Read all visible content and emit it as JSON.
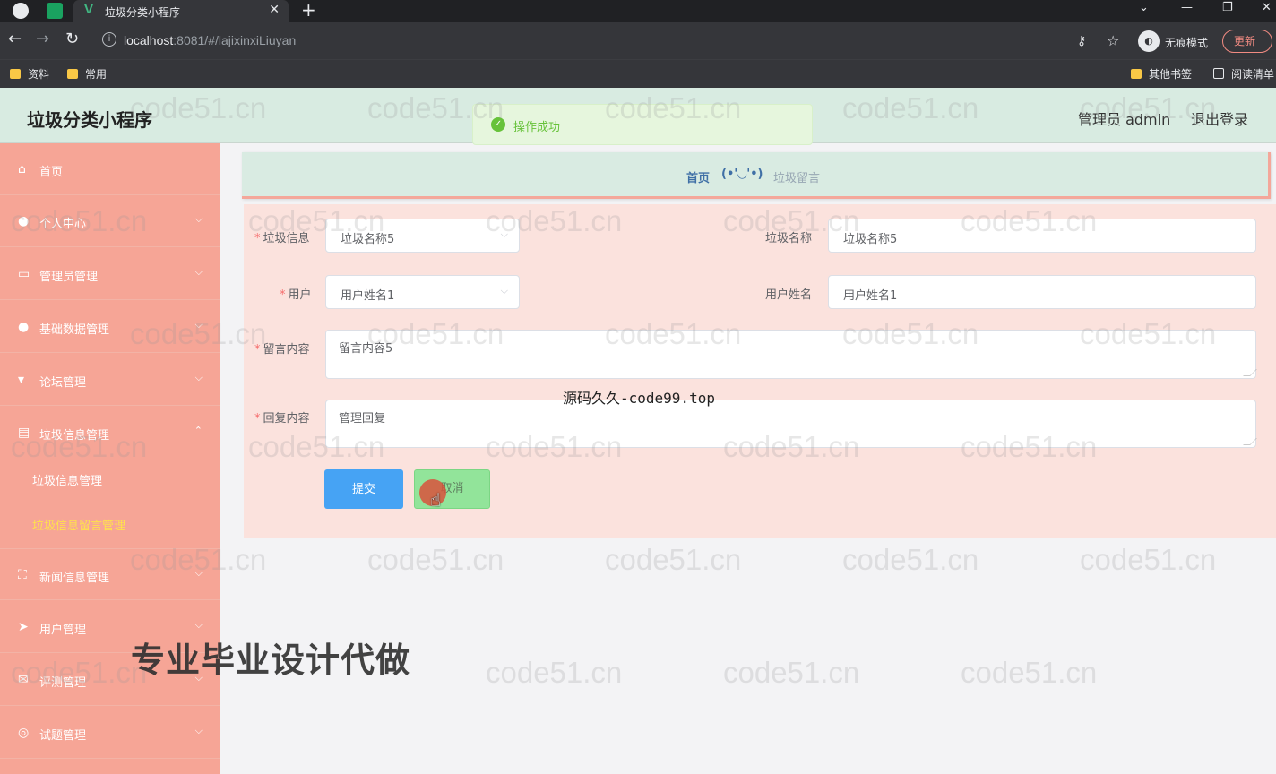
{
  "browser": {
    "tab_title": "垃圾分类小程序",
    "url_host": "localhost",
    "url_rest": ":8081/#/lajixinxiLiuyan",
    "incognito_label": "无痕模式",
    "update_label": "更新",
    "bookmarks": [
      "资料",
      "常用"
    ],
    "bookmarks_right": [
      "其他书签",
      "阅读清单"
    ]
  },
  "app": {
    "title": "垃圾分类小程序",
    "user": "管理员 admin",
    "logout": "退出登录",
    "toast": "操作成功"
  },
  "sidebar": {
    "items": [
      {
        "label": "首页",
        "icon": "home-icon"
      },
      {
        "label": "个人中心",
        "icon": "user-icon"
      },
      {
        "label": "管理员管理",
        "icon": "card-icon"
      },
      {
        "label": "基础数据管理",
        "icon": "user-group-icon"
      },
      {
        "label": "论坛管理",
        "icon": "cup-icon"
      },
      {
        "label": "垃圾信息管理",
        "icon": "document-icon"
      },
      {
        "label": "新闻信息管理",
        "icon": "fullscreen-icon"
      },
      {
        "label": "用户管理",
        "icon": "send-icon"
      },
      {
        "label": "评测管理",
        "icon": "mail-icon"
      },
      {
        "label": "试题管理",
        "icon": "globe-icon"
      }
    ],
    "submenu": [
      "垃圾信息管理",
      "垃圾信息留言管理"
    ]
  },
  "breadcrumb": {
    "home": "首页",
    "emoticon": "(•'◡'•)",
    "current": "垃圾留言"
  },
  "form": {
    "garbage_info_label": "垃圾信息",
    "garbage_info_value": "垃圾名称5",
    "garbage_name_label": "垃圾名称",
    "garbage_name_value": "垃圾名称5",
    "user_label": "用户",
    "user_value": "用户姓名1",
    "user_name_label": "用户姓名",
    "user_name_value": "用户姓名1",
    "message_label": "留言内容",
    "message_value": "留言内容5",
    "reply_label": "回复内容",
    "reply_value": "管理回复",
    "submit": "提交",
    "cancel": "取消"
  },
  "overlays": {
    "watermark": "code51.cn",
    "mono_caption": "源码久久-code99.top",
    "big_caption": "专业毕业设计代做"
  },
  "colors": {
    "sidebar": "#f6a596",
    "header": "#d8ebe1",
    "submit": "#46a3f4",
    "cancel": "#92e49a",
    "active_submenu": "#ffe14d"
  }
}
